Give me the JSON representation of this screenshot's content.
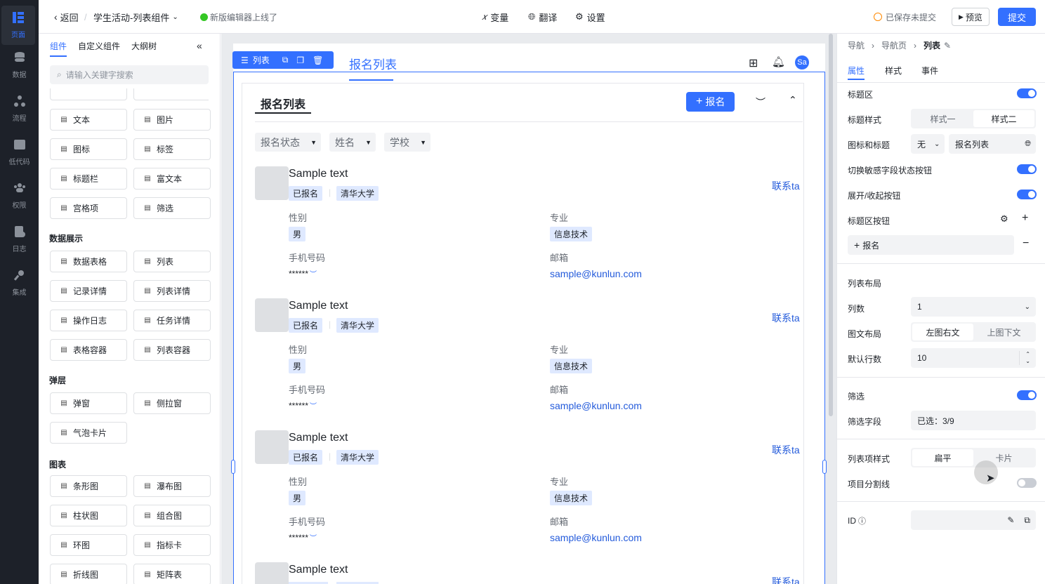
{
  "nav": [
    {
      "label": "页面",
      "icon": "page-icon",
      "active": true
    },
    {
      "label": "数据",
      "icon": "database-icon"
    },
    {
      "label": "流程",
      "icon": "flow-icon"
    },
    {
      "label": "低代码",
      "icon": "code-icon"
    },
    {
      "label": "权限",
      "icon": "users-icon"
    },
    {
      "label": "日志",
      "icon": "log-icon"
    },
    {
      "label": "集成",
      "icon": "key-icon"
    }
  ],
  "topbar": {
    "back": "返回",
    "page_name": "学生活动-列表组件",
    "notice": "新版编辑器上线了",
    "variables": "变量",
    "translate": "翻译",
    "settings": "设置",
    "save_status": "已保存未提交",
    "preview": "预览",
    "submit": "提交"
  },
  "components": {
    "tabs": [
      "组件",
      "自定义组件",
      "大纲树"
    ],
    "search_placeholder": "请输入关键字搜索",
    "basic": [
      [
        "文本",
        "图片"
      ],
      [
        "图标",
        "标签"
      ],
      [
        "标题栏",
        "富文本"
      ],
      [
        "宫格项",
        "筛选"
      ]
    ],
    "data_title": "数据展示",
    "data": [
      [
        "数据表格",
        "列表"
      ],
      [
        "记录详情",
        "列表详情"
      ],
      [
        "操作日志",
        "任务详情"
      ],
      [
        "表格容器",
        "列表容器"
      ]
    ],
    "popup_title": "弹层",
    "popup": [
      [
        "弹窗",
        "侧拉窗"
      ],
      [
        "气泡卡片"
      ]
    ],
    "chart_title": "图表",
    "chart": [
      [
        "条形图",
        "瀑布图"
      ],
      [
        "柱状图",
        "组合图"
      ],
      [
        "环图",
        "指标卡"
      ],
      [
        "折线图",
        "矩阵表"
      ]
    ]
  },
  "canvas": {
    "toolbar_label": "列表",
    "page_title": "报名列表",
    "avatar": "Sa",
    "list_title": "报名列表",
    "add_button": "报名",
    "filters": [
      "报名状态",
      "姓名",
      "学校"
    ],
    "items": [
      {
        "name": "Sample text",
        "status": "已报名",
        "school": "清华大学",
        "action": "联系ta",
        "gender_label": "性别",
        "gender": "男",
        "major_label": "专业",
        "major": "信息技术",
        "phone_label": "手机号码",
        "phone": "******",
        "email_label": "邮箱",
        "email": "sample@kunlun.com"
      },
      {
        "name": "Sample text",
        "status": "已报名",
        "school": "清华大学",
        "action": "联系ta",
        "gender_label": "性别",
        "gender": "男",
        "major_label": "专业",
        "major": "信息技术",
        "phone_label": "手机号码",
        "phone": "******",
        "email_label": "邮箱",
        "email": "sample@kunlun.com"
      },
      {
        "name": "Sample text",
        "status": "已报名",
        "school": "清华大学",
        "action": "联系ta",
        "gender_label": "性别",
        "gender": "男",
        "major_label": "专业",
        "major": "信息技术",
        "phone_label": "手机号码",
        "phone": "******",
        "email_label": "邮箱",
        "email": "sample@kunlun.com"
      },
      {
        "name": "Sample text",
        "status": "",
        "school": "",
        "action": "联系ta"
      }
    ]
  },
  "props": {
    "breadcrumb": [
      "导航",
      "导航页",
      "列表"
    ],
    "tabs": [
      "属性",
      "样式",
      "事件"
    ],
    "title_area": "标题区",
    "title_style": "标题样式",
    "title_style_options": [
      "样式一",
      "样式二"
    ],
    "icon_title": "图标和标题",
    "icon_value": "无",
    "title_value": "报名列表",
    "sensitive_toggle": "切换敏感字段状态按钮",
    "expand_toggle": "展开/收起按钮",
    "title_buttons": "标题区按钮",
    "title_button_item": "报名",
    "list_layout": "列表布局",
    "columns_label": "列数",
    "columns_value": "1",
    "img_layout_label": "图文布局",
    "img_layout_options": [
      "左图右文",
      "上图下文"
    ],
    "rows_label": "默认行数",
    "rows_value": "10",
    "filter_label": "筛选",
    "filter_field_label": "筛选字段",
    "filter_field_value": "已选：3/9",
    "item_style_label": "列表项样式",
    "item_style_options": [
      "扁平",
      "卡片"
    ],
    "divider_label": "项目分割线",
    "id_label": "ID"
  }
}
